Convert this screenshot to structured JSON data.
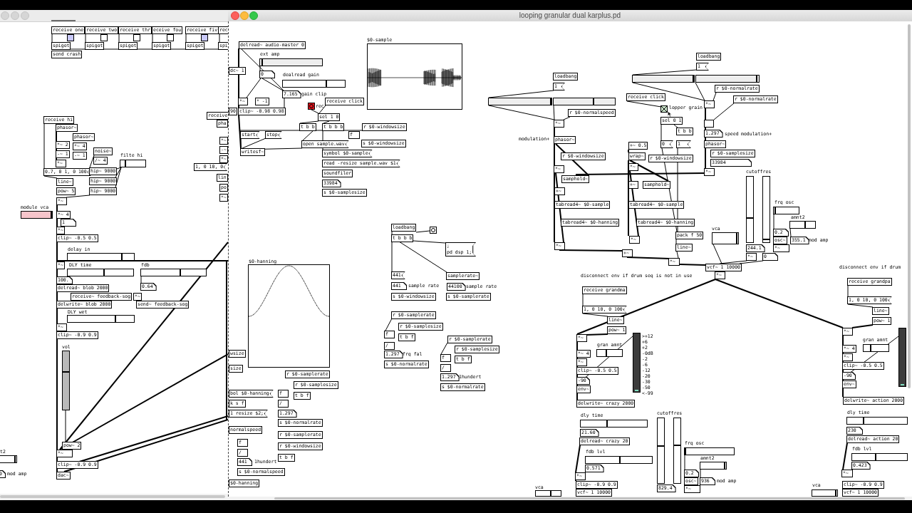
{
  "back_window": {
    "objects": [
      {
        "kind": "obj",
        "text": "receive one"
      },
      {
        "kind": "obj",
        "text": "receive two"
      },
      {
        "kind": "obj",
        "text": "receive thr"
      },
      {
        "kind": "obj",
        "text": "eceive fou"
      },
      {
        "kind": "obj",
        "text": "receive fiv"
      },
      {
        "kind": "obj",
        "text": "rec"
      },
      {
        "kind": "toggle",
        "checked": false,
        "color": "#c8c8f8"
      },
      {
        "kind": "toggle",
        "checked": false,
        "color": "#ffffff"
      },
      {
        "kind": "toggle",
        "checked": false,
        "color": "#ffffff"
      },
      {
        "kind": "toggle",
        "checked": false,
        "color": "#ffffff"
      },
      {
        "kind": "toggle",
        "checked": false,
        "color": "#c8c8f8"
      },
      {
        "kind": "obj",
        "text": "spigot"
      },
      {
        "kind": "obj",
        "text": "spigot"
      },
      {
        "kind": "obj",
        "text": "spigot"
      },
      {
        "kind": "obj",
        "text": "spigot"
      },
      {
        "kind": "obj",
        "text": "spigot"
      },
      {
        "kind": "obj",
        "text": "spi"
      },
      {
        "kind": "obj",
        "text": "send crash"
      },
      {
        "kind": "obj",
        "text": "receive hi"
      },
      {
        "kind": "obj",
        "text": "phasor~"
      },
      {
        "kind": "obj",
        "text": "phasor~"
      },
      {
        "kind": "obj",
        "text": "*~ 2"
      },
      {
        "kind": "obj",
        "text": "*~ 4"
      },
      {
        "kind": "obj",
        "text": "-~ 1"
      },
      {
        "kind": "obj",
        "text": "-~ 1"
      },
      {
        "kind": "obj",
        "text": "noise~"
      },
      {
        "kind": "obj",
        "text": "*~"
      },
      {
        "kind": "obj",
        "text": "/~ 4"
      },
      {
        "kind": "comment",
        "text": "filte hi"
      },
      {
        "kind": "hslider",
        "level": 0.2
      },
      {
        "kind": "msg",
        "text": "0.7, 0 1, 0 100"
      },
      {
        "kind": "obj",
        "text": "hip~ 9000"
      },
      {
        "kind": "obj",
        "text": "line~"
      },
      {
        "kind": "obj",
        "text": "hip~ 9000"
      },
      {
        "kind": "obj",
        "text": "pow~ 5"
      },
      {
        "kind": "obj",
        "text": "hip~ 9000"
      },
      {
        "kind": "obj",
        "text": "*~"
      },
      {
        "kind": "comment",
        "text": "module vca"
      },
      {
        "kind": "hslider",
        "level": 0.97,
        "color": "#f7c5cb"
      },
      {
        "kind": "obj",
        "text": "*~ 4"
      },
      {
        "kind": "num",
        "text": "1"
      },
      {
        "kind": "obj",
        "text": "*~"
      },
      {
        "kind": "obj",
        "text": "clip~ -0.5 0.5"
      },
      {
        "kind": "comment",
        "text": "delay in"
      },
      {
        "kind": "hslider",
        "level": 0.82
      },
      {
        "kind": "obj",
        "text": "*~"
      },
      {
        "kind": "comment",
        "text": "DLY time"
      },
      {
        "kind": "comment",
        "text": "fdb"
      },
      {
        "kind": "hslider",
        "level": 0.55
      },
      {
        "kind": "hslider",
        "level": 0.6
      },
      {
        "kind": "num",
        "text": "100."
      },
      {
        "kind": "obj",
        "text": "delread~ blob 2000"
      },
      {
        "kind": "num",
        "text": "0.64"
      },
      {
        "kind": "obj",
        "text": "receive~ feedback-sog"
      },
      {
        "kind": "obj",
        "text": "*~"
      },
      {
        "kind": "obj",
        "text": "delwrite~ blob 2000"
      },
      {
        "kind": "obj",
        "text": "send~ feedback-sog"
      },
      {
        "kind": "comment",
        "text": "DLY wet"
      },
      {
        "kind": "hslider",
        "level": 0.72
      },
      {
        "kind": "obj",
        "text": "*~"
      },
      {
        "kind": "obj",
        "text": "clip~ -0.9 0.9"
      },
      {
        "kind": "comment",
        "text": "vol"
      },
      {
        "kind": "vslider",
        "level": 0.65,
        "color": "#b9b9b9"
      },
      {
        "kind": "obj",
        "text": "pow~ 2"
      },
      {
        "kind": "comment",
        "text": "t2"
      },
      {
        "kind": "hslider",
        "level": 0.95
      },
      {
        "kind": "obj",
        "text": "*~"
      },
      {
        "kind": "obj",
        "text": "clip~ -0.9 0.9"
      },
      {
        "kind": "num",
        "text": "0"
      },
      {
        "kind": "comment",
        "text": "mod amp"
      },
      {
        "kind": "obj",
        "text": "dac~"
      },
      {
        "kind": "obj",
        "text": "receive"
      },
      {
        "kind": "obj",
        "text": "pha"
      },
      {
        "kind": "obj",
        "text": "*~"
      },
      {
        "kind": "obj",
        "text": "-~"
      },
      {
        "kind": "obj",
        "text": "*~"
      },
      {
        "kind": "msg",
        "text": "1, 0 10, 0"
      },
      {
        "kind": "obj",
        "text": "lin"
      },
      {
        "kind": "obj",
        "text": "po"
      },
      {
        "kind": "obj",
        "text": "*~"
      }
    ]
  },
  "main_window": {
    "title": "looping granular dual karplus.pd",
    "objects": [
      {
        "kind": "obj",
        "text": "delread~ audio-master 0"
      },
      {
        "kind": "comment",
        "text": "ext amp"
      },
      {
        "kind": "hslider",
        "level": 0.03,
        "color": "#eeeeee"
      },
      {
        "kind": "obj",
        "text": "dc~ 1"
      },
      {
        "kind": "num",
        "text": "0"
      },
      {
        "kind": "comment",
        "text": "dealread gain"
      },
      {
        "kind": "hslider",
        "level": 0.7
      },
      {
        "kind": "num",
        "text": "7.165"
      },
      {
        "kind": "comment",
        "text": "gain clip"
      },
      {
        "kind": "obj",
        "text": "*~"
      },
      {
        "kind": "obj",
        "text": "* -1"
      },
      {
        "kind": "bang",
        "color": "#e3141e"
      },
      {
        "kind": "comment",
        "text": "rec"
      },
      {
        "kind": "obj",
        "text": "receive click"
      },
      {
        "kind": "obj",
        "text": "90"
      },
      {
        "kind": "obj",
        "text": "clip~ -0.98 0.98"
      },
      {
        "kind": "obj",
        "text": "sel 1 0"
      },
      {
        "kind": "obj",
        "text": "t b b"
      },
      {
        "kind": "obj",
        "text": "t b b b"
      },
      {
        "kind": "obj",
        "text": "r $0-windowsize"
      },
      {
        "kind": "msg",
        "text": "start"
      },
      {
        "kind": "msg",
        "text": "stop"
      },
      {
        "kind": "obj",
        "text": "f"
      },
      {
        "kind": "msg",
        "text": "open sample.wav"
      },
      {
        "kind": "obj",
        "text": "s $0-windowsize"
      },
      {
        "kind": "obj",
        "text": "writesf~"
      },
      {
        "kind": "msg",
        "text": "symbol $0-sample"
      },
      {
        "kind": "msg",
        "text": "read -resize sample.wav $1"
      },
      {
        "kind": "obj",
        "text": "soundfiler"
      },
      {
        "kind": "num",
        "text": "33984"
      },
      {
        "kind": "obj",
        "text": "s $0-samplesize"
      },
      {
        "kind": "array",
        "label": "$0-sample"
      },
      {
        "kind": "obj",
        "text": "loadbang"
      },
      {
        "kind": "bang"
      },
      {
        "kind": "obj",
        "text": "t b b b"
      },
      {
        "kind": "msg",
        "text": ";\npd dsp 1;"
      },
      {
        "kind": "msg",
        "text": "441"
      },
      {
        "kind": "obj",
        "text": "samplerate~"
      },
      {
        "kind": "num",
        "text": "441"
      },
      {
        "kind": "comment",
        "text": "sample rate"
      },
      {
        "kind": "num",
        "text": "44100"
      },
      {
        "kind": "comment",
        "text": "sample rate"
      },
      {
        "kind": "obj",
        "text": "s $0-windowsize"
      },
      {
        "kind": "obj",
        "text": "s $0-samplerate"
      },
      {
        "kind": "obj",
        "text": "r $0-samplerate"
      },
      {
        "kind": "obj",
        "text": "r $0-samplesize"
      },
      {
        "kind": "obj",
        "text": "f"
      },
      {
        "kind": "obj",
        "text": "t b f"
      },
      {
        "kind": "obj",
        "text": "/"
      },
      {
        "kind": "num",
        "text": "1.297"
      },
      {
        "kind": "comment",
        "text": "frq fal"
      },
      {
        "kind": "obj",
        "text": "s $0-normalrate"
      },
      {
        "kind": "obj",
        "text": "r $0-samplerate"
      },
      {
        "kind": "obj",
        "text": "r $0-samplesize"
      },
      {
        "kind": "obj",
        "text": "f"
      },
      {
        "kind": "obj",
        "text": "t b f"
      },
      {
        "kind": "obj",
        "text": "/"
      },
      {
        "kind": "num",
        "text": "1.297"
      },
      {
        "kind": "comment",
        "text": "1hundert"
      },
      {
        "kind": "obj",
        "text": "s $0-normalrate"
      },
      {
        "kind": "array",
        "label": "$0-hanning"
      },
      {
        "kind": "obj",
        "text": "wsize"
      },
      {
        "kind": "obj",
        "text": "size"
      },
      {
        "kind": "msg",
        "text": "bol $0-hanning"
      },
      {
        "kind": "obj",
        "text": "k s f"
      },
      {
        "kind": "msg",
        "text": "1 resize $2;"
      },
      {
        "kind": "obj",
        "text": "normalspeed"
      },
      {
        "kind": "obj",
        "text": "f"
      },
      {
        "kind": "obj",
        "text": "/"
      },
      {
        "kind": "num",
        "text": "441"
      },
      {
        "kind": "comment",
        "text": "1hundert"
      },
      {
        "kind": "obj",
        "text": "s $0-normalspeed"
      },
      {
        "kind": "obj",
        "text": "$0-hanning"
      },
      {
        "kind": "obj",
        "text": "r $0-samplerate"
      },
      {
        "kind": "obj",
        "text": "r $0-samplesize"
      },
      {
        "kind": "obj",
        "text": "f"
      },
      {
        "kind": "obj",
        "text": "t b f"
      },
      {
        "kind": "obj",
        "text": "/"
      },
      {
        "kind": "num",
        "text": "1.297"
      },
      {
        "kind": "obj",
        "text": "s $0-normalrate"
      },
      {
        "kind": "obj",
        "text": "r $0-samplerate"
      },
      {
        "kind": "obj",
        "text": "r $0-windowsize"
      },
      {
        "kind": "obj",
        "text": "t b f"
      },
      {
        "kind": "obj",
        "text": "loadbang"
      },
      {
        "kind": "msg",
        "text": "1"
      },
      {
        "kind": "hslider",
        "level": 0.99,
        "color": "#eeeeee"
      },
      {
        "kind": "hslider",
        "level": 0.65,
        "color": "#eeeeee"
      },
      {
        "kind": "obj",
        "text": "r $0-normalspeed"
      },
      {
        "kind": "obj",
        "text": "*~"
      },
      {
        "kind": "comment",
        "text": "modulation+"
      },
      {
        "kind": "obj",
        "text": "phasor~"
      },
      {
        "kind": "obj",
        "text": "r $0-windowsize"
      },
      {
        "kind": "obj",
        "text": "*~"
      },
      {
        "kind": "obj",
        "text": "samphold~"
      },
      {
        "kind": "obj",
        "text": "+~"
      },
      {
        "kind": "obj",
        "text": "tabread4~ $0-sample"
      },
      {
        "kind": "obj",
        "text": "tabread4~ $0-hanning"
      },
      {
        "kind": "obj",
        "text": "*~"
      },
      {
        "kind": "obj",
        "text": "loadbang"
      },
      {
        "kind": "msg",
        "text": "1"
      },
      {
        "kind": "hslider",
        "level": 0.99,
        "color": "#eeeeee"
      },
      {
        "kind": "hslider",
        "level": 0.97,
        "color": "#eeeeee"
      },
      {
        "kind": "obj",
        "text": "r $0-normalrate"
      },
      {
        "kind": "obj",
        "text": "receive click"
      },
      {
        "kind": "obj",
        "text": "*~"
      },
      {
        "kind": "obj",
        "text": "r $0-normalrate"
      },
      {
        "kind": "toggle",
        "checked": true,
        "color": "#cfe9cf"
      },
      {
        "kind": "comment",
        "text": "lopper grain"
      },
      {
        "kind": "obj",
        "text": "sel 0 1"
      },
      {
        "kind": "obj",
        "text": "t b b"
      },
      {
        "kind": "num",
        "text": "1.297"
      },
      {
        "kind": "comment",
        "text": "speed"
      },
      {
        "kind": "comment",
        "text": "modulation+"
      },
      {
        "kind": "obj",
        "text": "+~ 0.5"
      },
      {
        "kind": "msg",
        "text": "0"
      },
      {
        "kind": "msg",
        "text": "1"
      },
      {
        "kind": "obj",
        "text": "phasor~"
      },
      {
        "kind": "obj",
        "text": "wrap~"
      },
      {
        "kind": "obj",
        "text": "r $0-windowsize"
      },
      {
        "kind": "obj",
        "text": "r $0-samplesize"
      },
      {
        "kind": "obj",
        "text": "*~"
      },
      {
        "kind": "num",
        "text": "33984"
      },
      {
        "kind": "obj",
        "text": "*~"
      },
      {
        "kind": "comment",
        "text": "cutoffres"
      },
      {
        "kind": "obj",
        "text": "+~"
      },
      {
        "kind": "obj",
        "text": "samphold~"
      },
      {
        "kind": "obj",
        "text": "tabread4~ $0-sample"
      },
      {
        "kind": "obj",
        "text": "tabread4~ $0-hanning"
      },
      {
        "kind": "vslider",
        "level": 0.37
      },
      {
        "kind": "vslider",
        "level": 0.04
      },
      {
        "kind": "comment",
        "text": "frq osc"
      },
      {
        "kind": "hslider",
        "level": 0.05
      },
      {
        "kind": "comment",
        "text": "amnt2"
      },
      {
        "kind": "comment",
        "text": "vca"
      },
      {
        "kind": "hslider",
        "level": 0.6
      },
      {
        "kind": "obj",
        "text": "*~"
      },
      {
        "kind": "obj",
        "text": "pack f 50"
      },
      {
        "kind": "hslider",
        "level": 0.95
      },
      {
        "kind": "num",
        "text": "0.2"
      },
      {
        "kind": "obj",
        "text": "osc~"
      },
      {
        "kind": "num",
        "text": "355.1"
      },
      {
        "kind": "comment",
        "text": "mod amp"
      },
      {
        "kind": "obj",
        "text": "+~"
      },
      {
        "kind": "obj",
        "text": "line~"
      },
      {
        "kind": "num",
        "text": "244.1"
      },
      {
        "kind": "obj",
        "text": "*~"
      },
      {
        "kind": "obj",
        "text": "*~"
      },
      {
        "kind": "obj",
        "text": "*~"
      },
      {
        "kind": "num",
        "text": "0"
      },
      {
        "kind": "obj",
        "text": "vcf~ 1 10000"
      },
      {
        "kind": "comment",
        "text": "disconnect env if drum"
      },
      {
        "kind": "comment",
        "text": "disconnect env if drum seq is not in use"
      },
      {
        "kind": "obj",
        "text": "*~"
      },
      {
        "kind": "obj",
        "text": "receive grandpa"
      },
      {
        "kind": "obj",
        "text": "receive grandma"
      },
      {
        "kind": "msg",
        "text": "1, 0 10, 0 100"
      },
      {
        "kind": "obj",
        "text": "line~"
      },
      {
        "kind": "obj",
        "text": "pow~ 1"
      },
      {
        "kind": "obj",
        "text": "*~"
      },
      {
        "kind": "vu",
        "level": 0.03,
        "scale": [
          ">+12",
          "+6",
          "+2",
          "-0dB",
          "-2",
          "-6",
          "-12",
          "-20",
          "-30",
          "-50",
          "<-99"
        ]
      },
      {
        "kind": "comment",
        "text": "gran amnt"
      },
      {
        "kind": "obj",
        "text": "*~ 4"
      },
      {
        "kind": "hslider",
        "level": 0.37
      },
      {
        "kind": "obj",
        "text": "*~"
      },
      {
        "kind": "obj",
        "text": "clip~ -0.5 0.5"
      },
      {
        "kind": "num",
        "text": "-90"
      },
      {
        "kind": "obj",
        "text": "env~"
      },
      {
        "kind": "obj",
        "text": "delwrite~ crazy 2000"
      },
      {
        "kind": "comment",
        "text": "dly time"
      },
      {
        "kind": "hslider",
        "level": 0.4
      },
      {
        "kind": "num",
        "text": "21.60"
      },
      {
        "kind": "obj",
        "text": "delread~ crazy 20"
      },
      {
        "kind": "comment",
        "text": "fdb lvl"
      },
      {
        "kind": "hslider",
        "level": 0.52
      },
      {
        "kind": "num",
        "text": "0.571"
      },
      {
        "kind": "obj",
        "text": "*~"
      },
      {
        "kind": "obj",
        "text": "clip~ -0.9 0.9"
      },
      {
        "kind": "comment",
        "text": "cutoffres"
      },
      {
        "kind": "vslider",
        "level": 0.57
      },
      {
        "kind": "vslider",
        "level": 0.58
      },
      {
        "kind": "num",
        "text": "829.4"
      },
      {
        "kind": "comment",
        "text": "frq osc"
      },
      {
        "kind": "hslider",
        "level": 0.02
      },
      {
        "kind": "comment",
        "text": "amnt2"
      },
      {
        "kind": "hslider",
        "level": 0.95
      },
      {
        "kind": "num",
        "text": "0.2"
      },
      {
        "kind": "obj",
        "text": "osc~"
      },
      {
        "kind": "num",
        "text": "936"
      },
      {
        "kind": "comment",
        "text": "mod amp"
      },
      {
        "kind": "comment",
        "text": "vca"
      },
      {
        "kind": "hslider",
        "level": 0.6
      },
      {
        "kind": "obj",
        "text": "vcf~ 1 10000"
      },
      {
        "kind": "obj",
        "text": "*~"
      },
      {
        "kind": "msg",
        "text": "1, 0 10, 0 100"
      },
      {
        "kind": "obj",
        "text": "line~"
      },
      {
        "kind": "obj",
        "text": "pow~ 1"
      },
      {
        "kind": "obj",
        "text": "*~"
      },
      {
        "kind": "vu",
        "level": 0.03
      },
      {
        "kind": "comment",
        "text": "gran amnt"
      },
      {
        "kind": "obj",
        "text": "*~ 4"
      },
      {
        "kind": "hslider",
        "level": 0.28
      },
      {
        "kind": "obj",
        "text": "*~"
      },
      {
        "kind": "obj",
        "text": "clip~ -0.5 0.5"
      },
      {
        "kind": "num",
        "text": "-90"
      },
      {
        "kind": "obj",
        "text": "env~"
      },
      {
        "kind": "obj",
        "text": "delwrite~ action 2000"
      },
      {
        "kind": "comment",
        "text": "dly time"
      },
      {
        "kind": "hslider",
        "level": 0.27
      },
      {
        "kind": "num",
        "text": "230"
      },
      {
        "kind": "obj",
        "text": "delread~ action 20"
      },
      {
        "kind": "comment",
        "text": "fdb lvl"
      },
      {
        "kind": "hslider",
        "level": 0.43
      },
      {
        "kind": "num",
        "text": "0.423"
      },
      {
        "kind": "obj",
        "text": "*~"
      },
      {
        "kind": "comment",
        "text": "vca"
      },
      {
        "kind": "obj",
        "text": "clip~ -0.9 0.9"
      },
      {
        "kind": "hslider",
        "level": 0.95
      },
      {
        "kind": "obj",
        "text": "vcf~ 1 10000"
      }
    ]
  }
}
